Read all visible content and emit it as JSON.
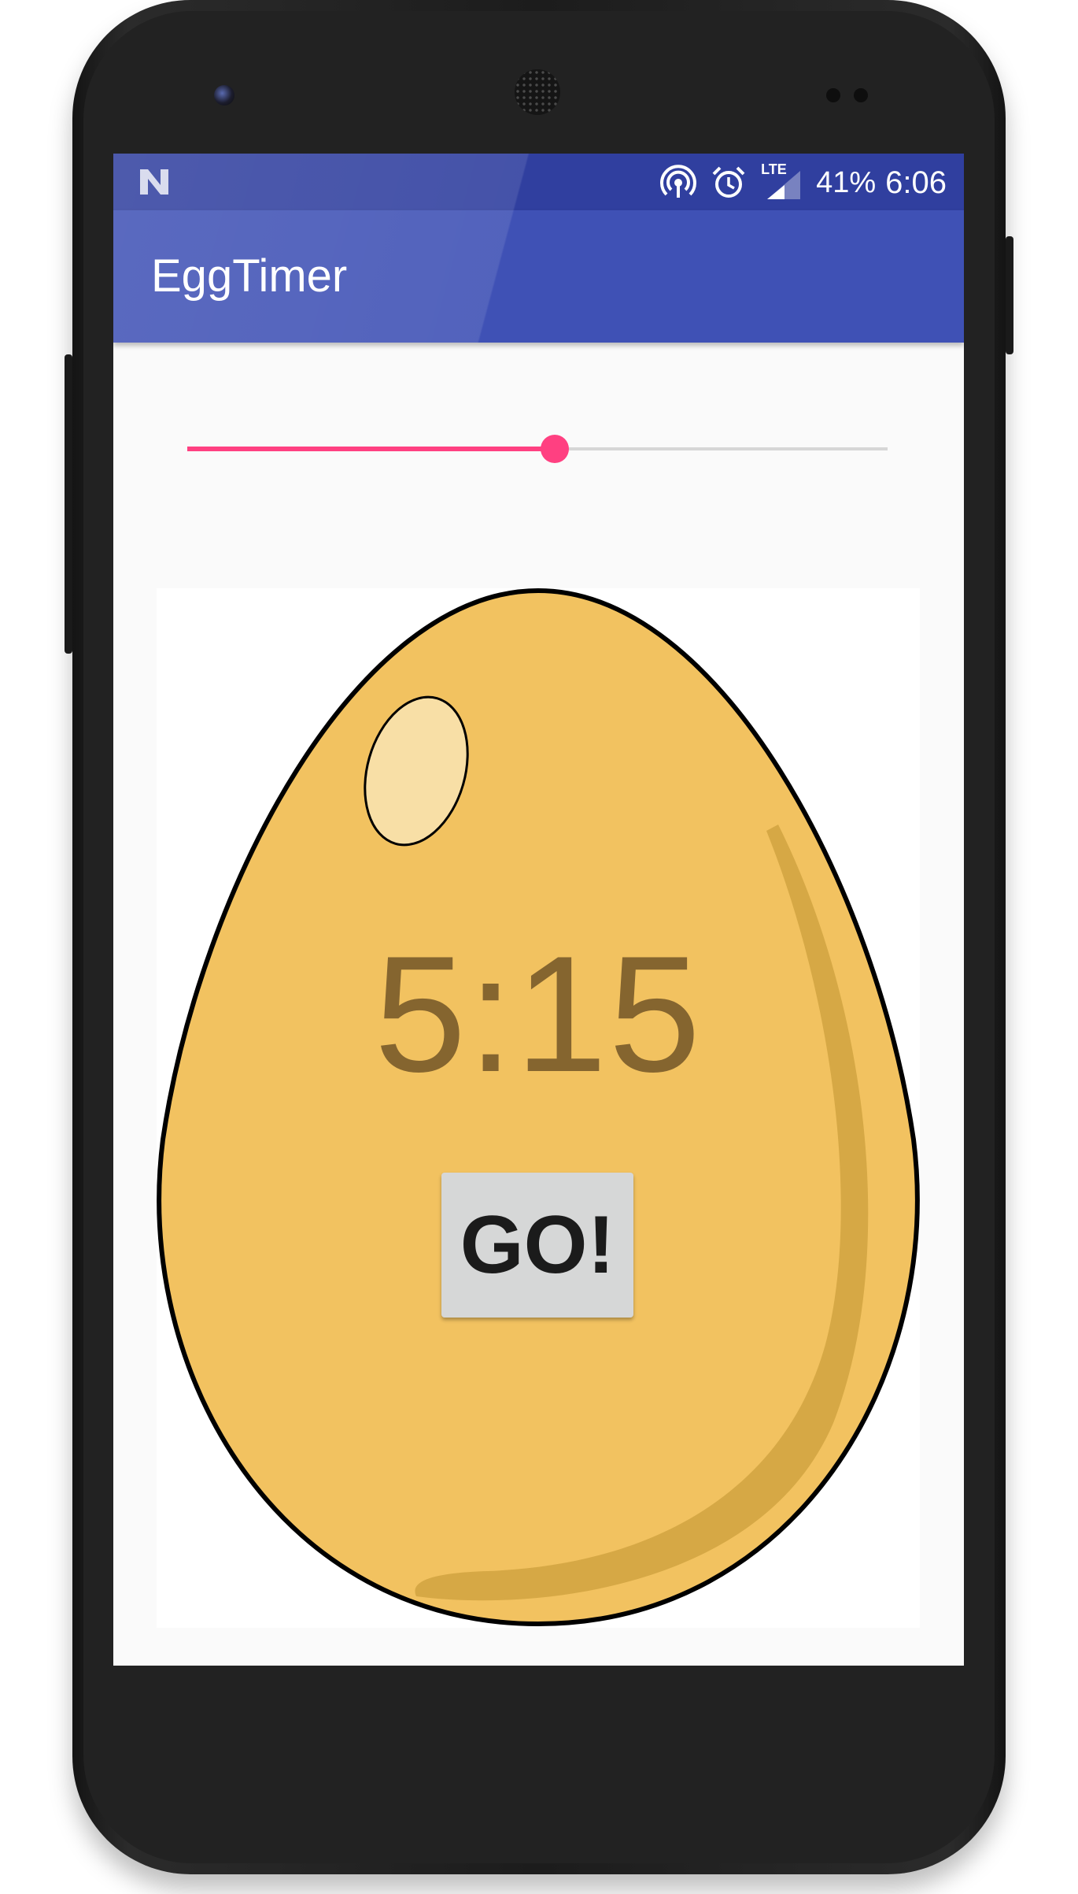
{
  "app": {
    "title": "EggTimer"
  },
  "status_bar": {
    "notification_icon": "n-notification-icon",
    "icons": [
      "hotspot-icon",
      "alarm-icon",
      "lte-signal-icon"
    ],
    "lte_label": "LTE",
    "battery": "41%",
    "time": "6:06",
    "color": "#303f9f"
  },
  "toolbar": {
    "color": "#3f51b5"
  },
  "seekbar": {
    "progress_fraction": 0.525,
    "accent_color": "#ff4081"
  },
  "timer": {
    "display": "5:15"
  },
  "go_button": {
    "label": "GO!"
  },
  "egg": {
    "fill_color": "#f2c260",
    "shadow_color": "#d6a845",
    "highlight_color": "#f8dfa6"
  }
}
